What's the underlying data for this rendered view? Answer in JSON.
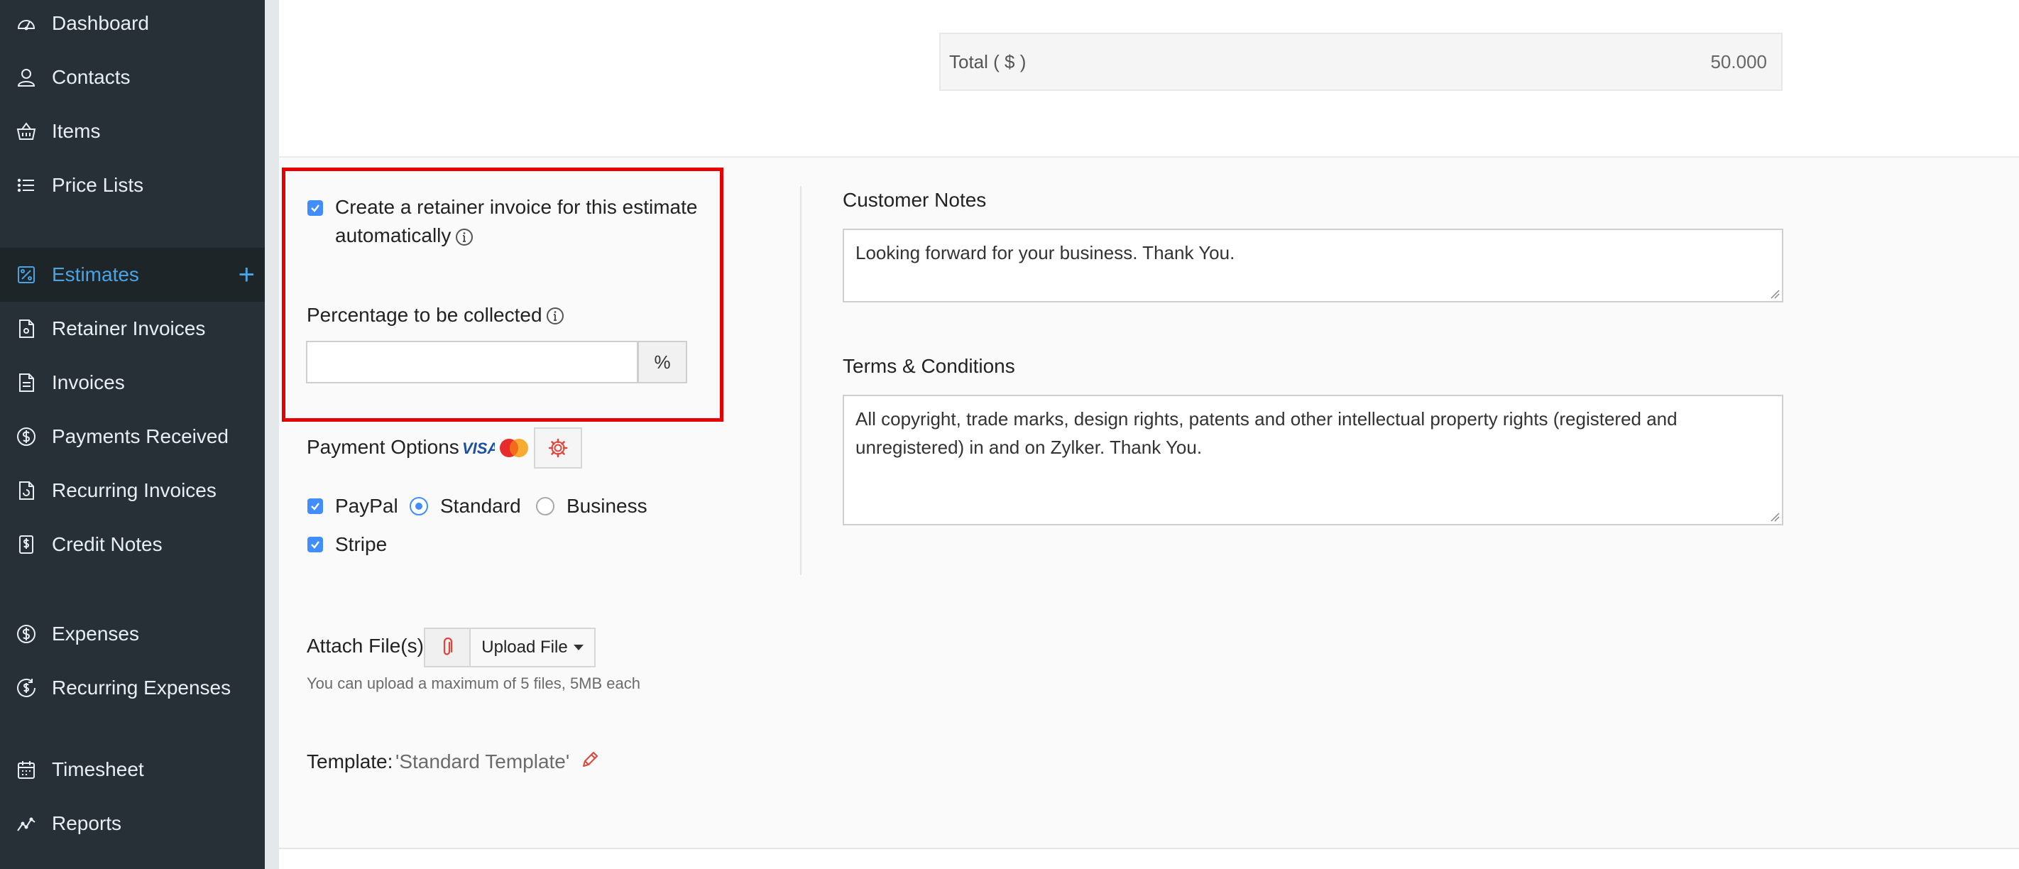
{
  "sidebar": {
    "items": [
      {
        "label": "Dashboard",
        "icon": "dashboard-icon"
      },
      {
        "label": "Contacts",
        "icon": "user-icon"
      },
      {
        "label": "Items",
        "icon": "basket-icon"
      },
      {
        "label": "Price Lists",
        "icon": "list-icon"
      },
      {
        "label": "Estimates",
        "icon": "estimate-icon",
        "active": true
      },
      {
        "label": "Retainer Invoices",
        "icon": "retainer-invoice-icon"
      },
      {
        "label": "Invoices",
        "icon": "invoice-icon"
      },
      {
        "label": "Payments Received",
        "icon": "payment-icon"
      },
      {
        "label": "Recurring Invoices",
        "icon": "recurring-invoice-icon"
      },
      {
        "label": "Credit Notes",
        "icon": "credit-note-icon"
      },
      {
        "label": "Expenses",
        "icon": "expense-icon"
      },
      {
        "label": "Recurring Expenses",
        "icon": "recurring-expense-icon"
      },
      {
        "label": "Timesheet",
        "icon": "timesheet-icon"
      },
      {
        "label": "Reports",
        "icon": "reports-icon"
      }
    ],
    "add_symbol": "+"
  },
  "totals": {
    "label": "Total ( $ )",
    "value": "50.000"
  },
  "retainer": {
    "checkbox_label_line1": "Create a retainer invoice for this estimate",
    "checkbox_label_line2": "automatically",
    "checked": true,
    "percentage_label": "Percentage to be collected",
    "percentage_value": "",
    "percent_symbol": "%"
  },
  "payment": {
    "label": "Payment Options",
    "card_brands": [
      "VISA",
      "Mastercard"
    ],
    "paypal_label": "PayPal",
    "paypal_checked": true,
    "standard_label": "Standard",
    "business_label": "Business",
    "selected_mode": "Standard",
    "stripe_label": "Stripe",
    "stripe_checked": true
  },
  "notes": {
    "customer_notes_label": "Customer Notes",
    "customer_notes_value": "Looking forward for your business. Thank You.",
    "terms_label": "Terms & Conditions",
    "terms_value": "All copyright, trade marks, design rights, patents and other intellectual property rights (registered and unregistered) in and on Zylker. Thank You."
  },
  "attach": {
    "label": "Attach File(s)",
    "upload_label": "Upload File",
    "hint": "You can upload a maximum of 5 files, 5MB each"
  },
  "template": {
    "label": "Template:",
    "name": "'Standard Template'"
  },
  "colors": {
    "sidebar_bg": "#273036",
    "accent": "#408dfb",
    "active_nav": "#4aa3e2",
    "highlight_border": "#e60000"
  }
}
